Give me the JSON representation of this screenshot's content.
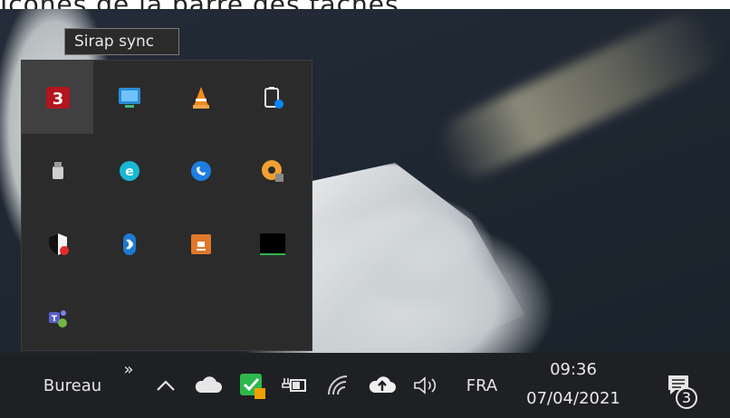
{
  "caption": {
    "text": "Icônes de la barre des tâches"
  },
  "tooltip": {
    "text": "Sirap sync"
  },
  "tray_flyout": {
    "icons": [
      "sirap-sync-icon",
      "remote-desktop-icon",
      "vlc-cone-icon",
      "battery-clipboard-icon",
      "usb-drive-icon",
      "edge-e-icon",
      "circular-phone-icon",
      "orange-disc-icon",
      "security-shield-icon",
      "bluetooth-icon",
      "java-cup-icon",
      "terminal-window-icon",
      "teams-icon"
    ]
  },
  "taskbar": {
    "toolbar_label": "Bureau",
    "overflow_glyph": "»",
    "language": "FRA",
    "time": "09:36",
    "date": "07/04/2021",
    "notification_count": "3",
    "icons": [
      "chevron-up-icon",
      "cloud-icon",
      "green-check-icon",
      "power-plug-battery-icon",
      "wifi-icon",
      "upload-cloud-icon",
      "speaker-icon",
      "notifications-icon"
    ]
  },
  "colors": {
    "taskbar_bg": "#1f2023",
    "flyout_bg": "#2b2b2b",
    "accent_blue": "#0a84ff"
  }
}
